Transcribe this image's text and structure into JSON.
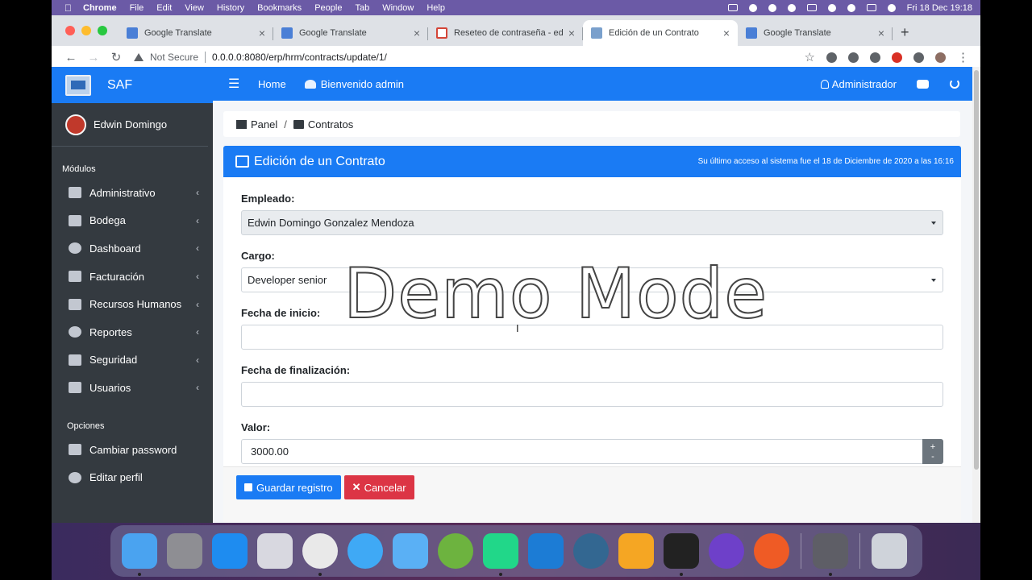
{
  "menubar": {
    "app": "Chrome",
    "items": [
      "File",
      "Edit",
      "View",
      "History",
      "Bookmarks",
      "People",
      "Tab",
      "Window",
      "Help"
    ],
    "clock": "Fri 18 Dec  19:18"
  },
  "browser": {
    "tabs": [
      {
        "label": "Google Translate",
        "icon": "google-translate-icon",
        "active": false
      },
      {
        "label": "Google Translate",
        "icon": "google-translate-icon",
        "active": false
      },
      {
        "label": "Reseteo de contraseña - edgo",
        "icon": "gmail-icon",
        "active": false
      },
      {
        "label": "Edición de un Contrato",
        "icon": "page-icon",
        "active": true
      },
      {
        "label": "Google Translate",
        "icon": "google-translate-icon",
        "active": false
      }
    ],
    "security": "Not Secure",
    "url": "0.0.0.0:8080/erp/hrm/contracts/update/1/"
  },
  "app": {
    "brand": "SAF",
    "user_name": "Edwin Domingo",
    "modules_header": "Módulos",
    "modules": [
      {
        "label": "Administrativo",
        "icon": "user-tie-icon"
      },
      {
        "label": "Bodega",
        "icon": "boxes-icon"
      },
      {
        "label": "Dashboard",
        "icon": "dashboard-icon"
      },
      {
        "label": "Facturación",
        "icon": "calculator-icon"
      },
      {
        "label": "Recursos Humanos",
        "icon": "toolbox-icon"
      },
      {
        "label": "Reportes",
        "icon": "pie-chart-icon"
      },
      {
        "label": "Seguridad",
        "icon": "lock-icon"
      },
      {
        "label": "Usuarios",
        "icon": "users-icon"
      }
    ],
    "options_header": "Opciones",
    "options": [
      {
        "label": "Cambiar password",
        "icon": "key-icon"
      },
      {
        "label": "Editar perfil",
        "icon": "user-icon"
      }
    ],
    "topnav": {
      "home": "Home",
      "welcome": "Bienvenido admin",
      "admin": "Administrador"
    },
    "breadcrumb": {
      "panel": "Panel",
      "separator": "/",
      "contracts": "Contratos"
    },
    "card": {
      "title": "Edición de un Contrato",
      "last_access": "Su último acceso al sistema fue el 18 de Diciembre de 2020 a las 16:16"
    },
    "form": {
      "employee_label": "Empleado:",
      "employee_value": "Edwin Domingo Gonzalez Mendoza",
      "position_label": "Cargo:",
      "position_value": "Developer senior",
      "start_label": "Fecha de inicio:",
      "start_value": "",
      "end_label": "Fecha de finalización:",
      "end_value": "",
      "amount_label": "Valor:",
      "amount_value": "3000.00",
      "spin_up": "+",
      "spin_down": "-"
    },
    "buttons": {
      "save": "Guardar registro",
      "cancel": "Cancelar"
    }
  },
  "overlay": {
    "watermark": "Demo Mode"
  },
  "dock": {
    "apps": [
      "Finder",
      "System Preferences",
      "App Store",
      "Launchpad",
      "Chrome",
      "Safari",
      "Mail",
      "Spring Tool Suite",
      "PyCharm",
      "Xcode",
      "pgAdmin",
      "Postico",
      "Terminal",
      "GitHub Desktop",
      "Postman",
      "Photo Booth",
      "Trash"
    ]
  },
  "colors": {
    "primary": "#1a7bf4",
    "sidebar": "#343a40",
    "danger": "#dc3545",
    "secondary": "#6c757d"
  }
}
